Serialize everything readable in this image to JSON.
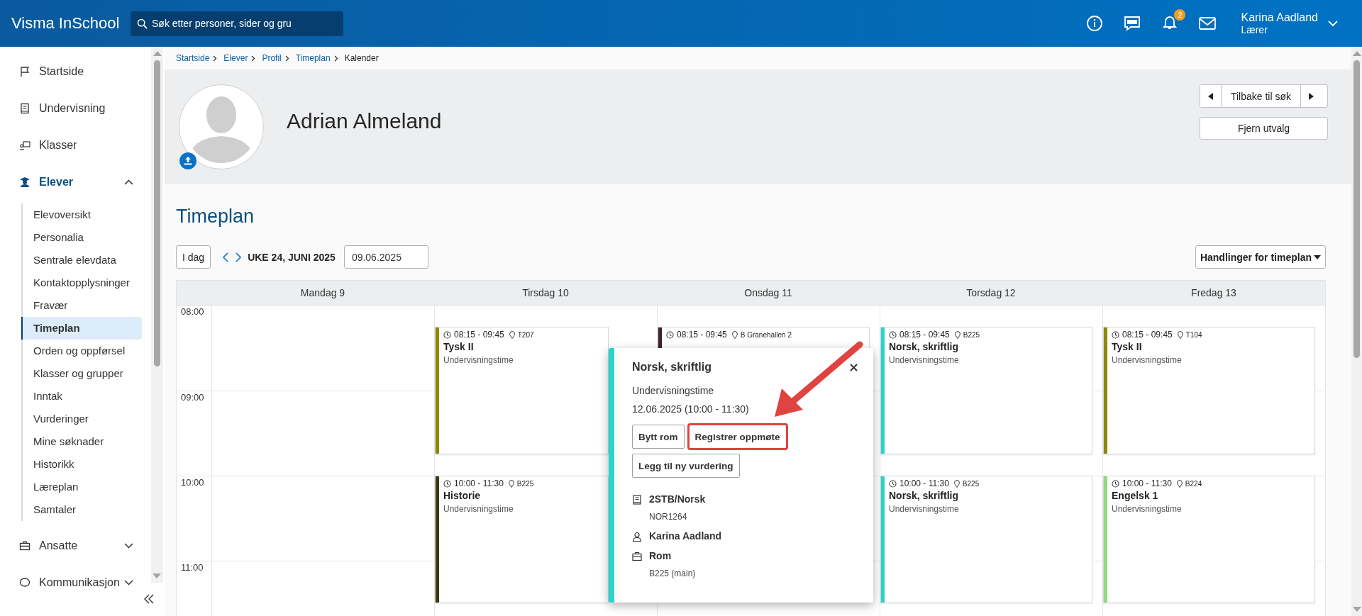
{
  "header": {
    "app_title": "Visma InSchool",
    "search": {
      "placeholder": "Søk etter personer, sider og gru"
    },
    "notification_count": "2",
    "user": {
      "name": "Karina Aadland",
      "role": "Lærer"
    }
  },
  "sidebar": {
    "items": [
      {
        "kind": "link",
        "label": "Startside"
      },
      {
        "kind": "link",
        "label": "Undervisning"
      },
      {
        "kind": "link",
        "label": "Klasser"
      },
      {
        "kind": "group",
        "label": "Elever",
        "expanded": true,
        "children": [
          {
            "label": "Elevoversikt",
            "selected": false
          },
          {
            "label": "Personalia",
            "selected": false
          },
          {
            "label": "Sentrale elevdata",
            "selected": false
          },
          {
            "label": "Kontaktopplysninger",
            "selected": false
          },
          {
            "label": "Fravær",
            "selected": false
          },
          {
            "label": "Timeplan",
            "selected": true
          },
          {
            "label": "Orden og oppførsel",
            "selected": false
          },
          {
            "label": "Klasser og grupper",
            "selected": false
          },
          {
            "label": "Inntak",
            "selected": false
          },
          {
            "label": "Vurderinger",
            "selected": false
          },
          {
            "label": "Mine søknader",
            "selected": false
          },
          {
            "label": "Historikk",
            "selected": false
          },
          {
            "label": "Læreplan",
            "selected": false
          },
          {
            "label": "Samtaler",
            "selected": false
          }
        ]
      },
      {
        "kind": "group",
        "label": "Ansatte",
        "expanded": false
      },
      {
        "kind": "group",
        "label": "Kommunikasjon",
        "expanded": false
      }
    ]
  },
  "breadcrumb": [
    {
      "label": "Startside",
      "current": false
    },
    {
      "label": "Elever",
      "current": false
    },
    {
      "label": "Profil",
      "current": false
    },
    {
      "label": "Timeplan",
      "current": false
    },
    {
      "label": "Kalender",
      "current": true
    }
  ],
  "profile": {
    "name": "Adrian Almeland",
    "back_button": "Tilbake til søk",
    "clear_button": "Fjern utvalg"
  },
  "timeplan": {
    "title": "Timeplan",
    "today_button": "I dag",
    "week_label": "UKE 24, JUNI 2025",
    "date_value": "09.06.2025",
    "actions_button": "Handlinger for timeplan"
  },
  "calendar": {
    "hours": [
      "08:00",
      "09:00",
      "10:00",
      "11:00"
    ],
    "days": [
      {
        "label": "Mandag 9"
      },
      {
        "label": "Tirsdag 10",
        "events": [
          {
            "time": "08:15 - 09:45",
            "room": "T207",
            "title": "Tysk II",
            "type": "Undervisningstime",
            "color": "#8c8a00"
          },
          {
            "time": "10:00 - 11:30",
            "room": "B225",
            "title": "Historie",
            "type": "Undervisningstime",
            "color": "#3f3712"
          }
        ]
      },
      {
        "label": "Onsdag 11",
        "events": [
          {
            "time": "08:15 - 09:45",
            "room": "B Granehallen 2",
            "color": "#3b2326"
          }
        ]
      },
      {
        "label": "Torsdag 12",
        "events": [
          {
            "time": "08:15 - 09:45",
            "room": "B225",
            "title": "Norsk, skriftlig",
            "type": "Undervisningstime",
            "color": "#2ad4cc"
          },
          {
            "time": "10:00 - 11:30",
            "room": "B225",
            "title": "Norsk, skriftlig",
            "type": "Undervisningstime",
            "color": "#2ad4cc"
          }
        ]
      },
      {
        "label": "Fredag 13",
        "events": [
          {
            "time": "08:15 - 09:45",
            "room": "T104",
            "title": "Tysk II",
            "type": "Undervisningstime",
            "color": "#8c8a00"
          },
          {
            "time": "10:00 - 11:30",
            "room": "B224",
            "title": "Engelsk 1",
            "type": "Undervisningstime",
            "color": "#8edc7c"
          }
        ]
      }
    ]
  },
  "popup": {
    "title": "Norsk, skriftlig",
    "type": "Undervisningstime",
    "datetime": "12.06.2025 (10:00 - 11:30)",
    "color": "#2ad4cc",
    "buttons": [
      {
        "label": "Bytt rom",
        "highlighted": false
      },
      {
        "label": "Registrer oppmøte",
        "highlighted": true
      },
      {
        "label": "Legg til ny vurdering",
        "highlighted": false
      }
    ],
    "details": [
      {
        "kind": "course",
        "title": "2STB/Norsk",
        "subtitle": "NOR1264"
      },
      {
        "kind": "person",
        "title": "Karina Aadland"
      },
      {
        "kind": "room",
        "title": "Rom",
        "subtitle": "B225 (main)"
      }
    ]
  }
}
